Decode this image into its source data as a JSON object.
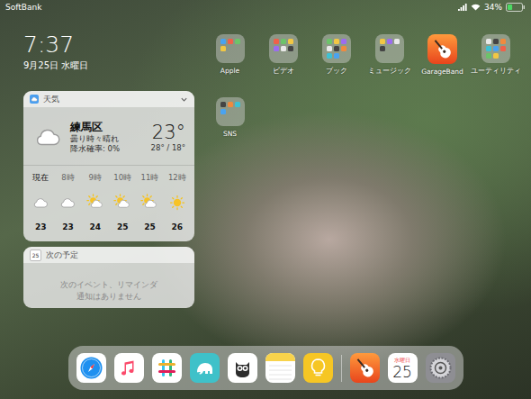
{
  "status_bar": {
    "carrier": "SoftBank",
    "battery": {
      "reading": "34%",
      "level": 0.34,
      "charging": true
    }
  },
  "lock": {
    "time": "7:37",
    "date": "9月25日 水曜日"
  },
  "weather": {
    "title": "天気",
    "expanded": false,
    "location": "練馬区",
    "condition": "曇り時々晴れ",
    "precipitation": "降水確率: 0%",
    "temp": "23°",
    "high_low": "28° / 18°",
    "hours": [
      {
        "label": "現在",
        "temp": "23",
        "kind": "cloudy"
      },
      {
        "label": "8時",
        "temp": "23",
        "kind": "cloudy"
      },
      {
        "label": "9時",
        "temp": "24",
        "kind": "partly"
      },
      {
        "label": "10時",
        "temp": "25",
        "kind": "partly"
      },
      {
        "label": "11時",
        "temp": "25",
        "kind": "partly"
      },
      {
        "label": "12時",
        "temp": "26",
        "kind": "sunny"
      }
    ]
  },
  "up_next": {
    "title": "次の予定",
    "icon_day": "25",
    "lines": [
      "次のイベント、リマインダ",
      "通知はありません"
    ]
  },
  "home": {
    "apps": [
      {
        "label": "Apple",
        "kind": "folder"
      },
      {
        "label": "ビデオ",
        "kind": "folder"
      },
      {
        "label": "ブック",
        "kind": "folder"
      },
      {
        "label": "ミュージック",
        "kind": "folder"
      },
      {
        "label": "GarageBand",
        "kind": "garageband"
      },
      {
        "label": "ユーティリティ",
        "kind": "folder"
      },
      {
        "label": "SNS",
        "kind": "folder"
      }
    ]
  },
  "dock": {
    "apps": [
      {
        "kind": "safari"
      },
      {
        "kind": "music"
      },
      {
        "kind": "slack"
      },
      {
        "kind": "elephant"
      },
      {
        "kind": "owl"
      },
      {
        "kind": "notes"
      },
      {
        "kind": "tips"
      }
    ],
    "recent": [
      {
        "kind": "garageband"
      },
      {
        "kind": "calendar",
        "weekday": "水曜日",
        "day": "25"
      },
      {
        "kind": "settings"
      }
    ]
  }
}
